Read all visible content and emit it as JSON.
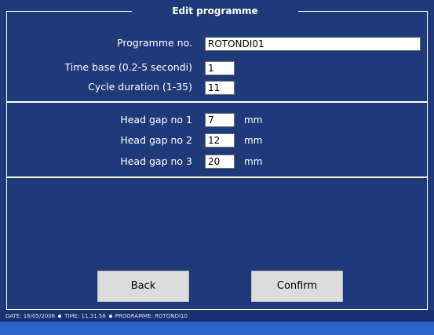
{
  "window": {
    "title": "Edit programme"
  },
  "form": {
    "programme_no": {
      "label": "Programme no.",
      "value": "ROTONDI01"
    },
    "time_base": {
      "label": "Time base (0.2-5 secondi)",
      "value": "1"
    },
    "cycle_duration": {
      "label": "Cycle duration (1-35)",
      "value": "11"
    }
  },
  "head_gaps": [
    {
      "label": "Head gap no 1",
      "value": "7",
      "unit": "mm"
    },
    {
      "label": "Head gap no 2",
      "value": "12",
      "unit": "mm"
    },
    {
      "label": "Head gap no 3",
      "value": "20",
      "unit": "mm"
    }
  ],
  "buttons": {
    "back": "Back",
    "confirm": "Confirm"
  },
  "status": {
    "date": "DATE: 16/05/2008",
    "time": "TIME: 11.31.58",
    "programme": "PROGRAMME: ROTONDI10"
  },
  "colors": {
    "background": "#1f3a78",
    "button": "#dcdcdc",
    "bottom_bar": "#2a64c8"
  }
}
